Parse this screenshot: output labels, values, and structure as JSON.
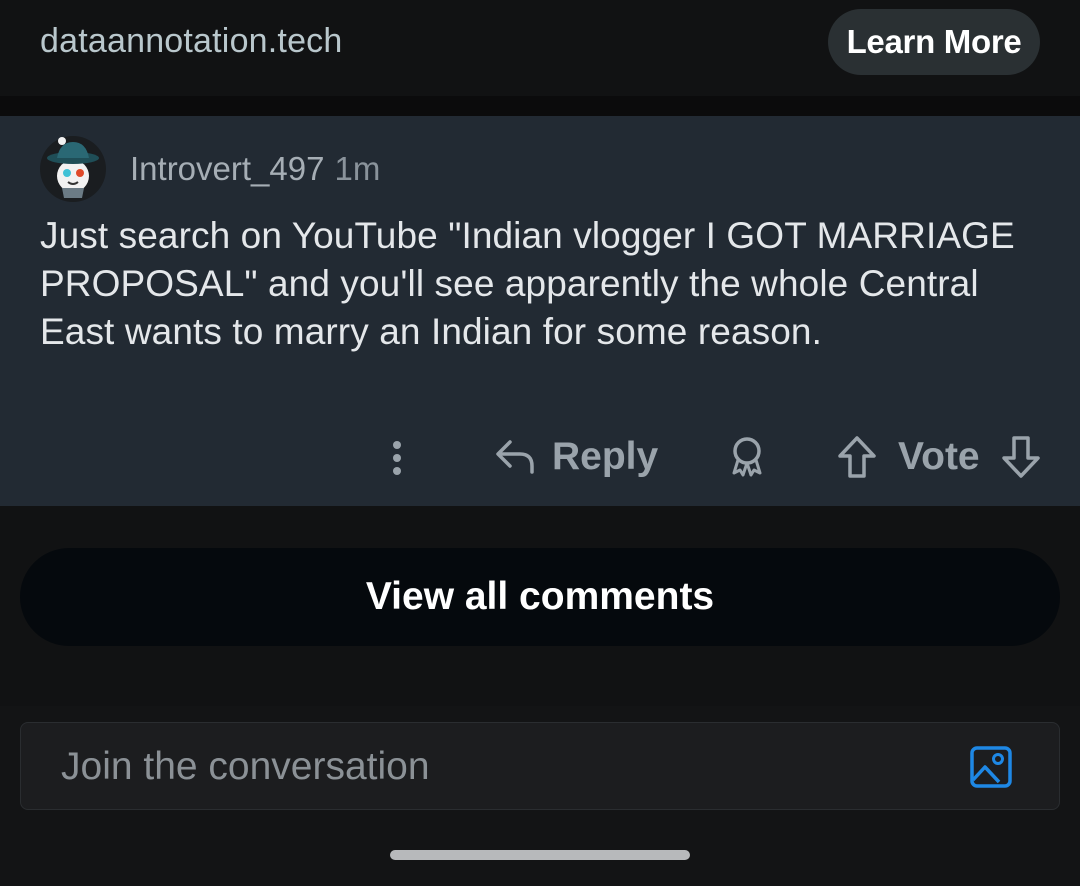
{
  "ad": {
    "domain": "dataannotation.tech",
    "cta_label": "Learn More"
  },
  "comment": {
    "author": "Introvert_497",
    "time": "1m",
    "body": "Just search on YouTube \"Indian vlogger I GOT MARRIAGE PROPOSAL\" and you'll see apparently the whole Central East wants to marry an Indian for some reason.",
    "actions": {
      "more_icon": "more-vertical-icon",
      "reply_label": "Reply",
      "reply_icon": "reply-arrow-icon",
      "award_icon": "award-icon",
      "upvote_icon": "upvote-arrow-icon",
      "vote_label": "Vote",
      "downvote_icon": "downvote-arrow-icon"
    }
  },
  "view_all_label": "View all comments",
  "composer": {
    "placeholder": "Join the conversation",
    "image_icon": "image-icon",
    "accent_color": "#1e88e5"
  }
}
